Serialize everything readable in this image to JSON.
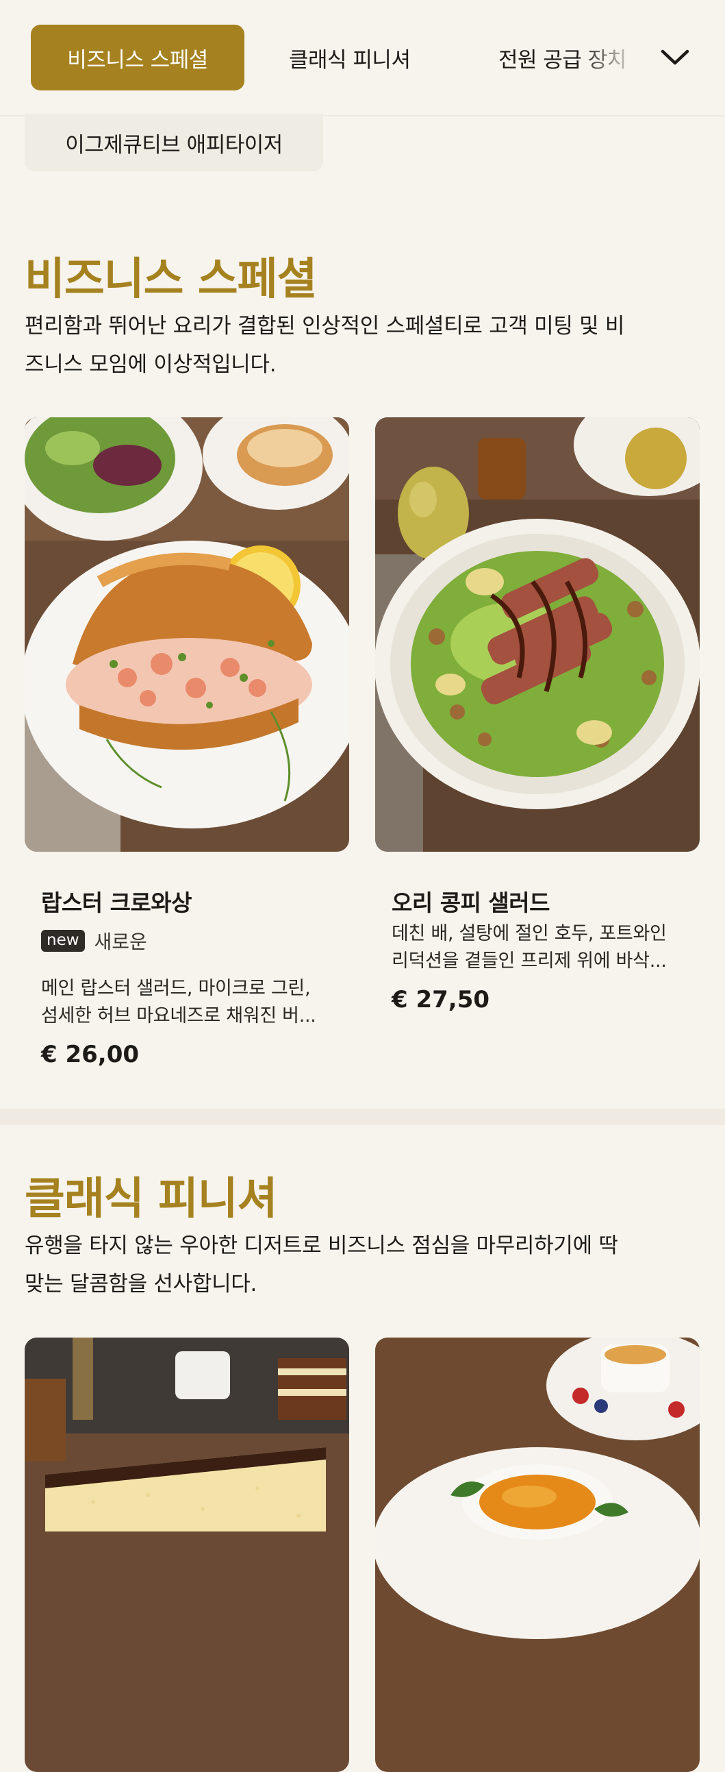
{
  "nav": {
    "tabs": [
      "비즈니스 스페셜",
      "클래식 피니셔",
      "전원 공급 장치"
    ],
    "active_index": 0,
    "subtab": "이그제큐티브 애피타이저",
    "expand_icon": "chevron-down-icon"
  },
  "sections": [
    {
      "title": "비즈니스 스페셜",
      "desc_lines": [
        "편리함과 뛰어난 요리가 결합된 인상적인 스페셜티로 고객 미팅 및 비",
        "즈니스 모임에 이상적입니다."
      ],
      "items": [
        {
          "name": "랍스터 크로와상",
          "badge": "new",
          "badge_text": "새로운",
          "desc_lines": [
            "메인 랍스터 샐러드, 마이크로 그린,",
            "섬세한 허브 마요네즈로 채워진 버..."
          ],
          "price": "€ 26,00",
          "image": "lobster-croissant-photo"
        },
        {
          "name": "오리 콩피 샐러드",
          "desc_lines": [
            "데친 배, 설탕에 절인 호두, 포트와인",
            "리덕션을 곁들인 프리제 위에 바삭..."
          ],
          "price": "€ 27,50",
          "image": "duck-confit-salad-photo"
        }
      ]
    },
    {
      "title": "클래식 피니셔",
      "desc_lines": [
        "유행을 타지 않는 우아한 디저트로 비즈니스 점심을 마무리하기에 딱",
        "맞는 달콤함을 선사합니다."
      ],
      "items": [
        {
          "image": "chocolate-cake-photo"
        },
        {
          "image": "creme-brulee-photo"
        }
      ]
    }
  ],
  "colors": {
    "accent": "#a5821f",
    "background": "#f7f4ee",
    "subtab_bg": "#efece4",
    "badge_bg": "#2f2b27"
  }
}
